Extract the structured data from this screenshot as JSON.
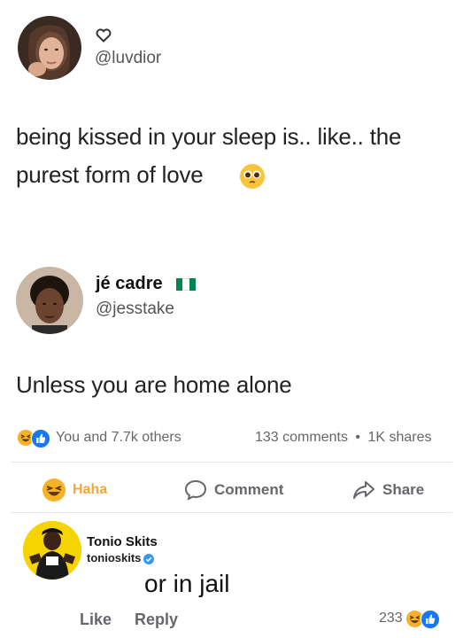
{
  "tweet1": {
    "handle": "@luvdior",
    "text_line1": "being kissed in your sleep is.. like.. the",
    "text_line2": "purest form of love"
  },
  "tweet2": {
    "name": "jé cadre",
    "handle": "@jesstake",
    "text": "Unless you are home alone"
  },
  "stats": {
    "reactions": "You and 7.7k others",
    "comments": "133 comments",
    "dot": "•",
    "shares": "1K shares"
  },
  "actions": {
    "haha": "Haha",
    "comment": "Comment",
    "share": "Share"
  },
  "comment": {
    "author": "Tonio Skits",
    "author_handle": "tonioskits",
    "text": "or in jail",
    "like": "Like",
    "reply": "Reply",
    "reaction_count": "233"
  },
  "colors": {
    "haha_yellow": "#f7b125",
    "like_blue": "#1877f2",
    "nigeria_green": "#008751"
  },
  "icons": [
    "heart-icon",
    "pleading-face-emoji-icon",
    "nigeria-flag-icon",
    "haha-emoji-icon",
    "like-reaction-icon",
    "comment-bubble-icon",
    "share-arrow-icon",
    "verified-badge-icon"
  ]
}
